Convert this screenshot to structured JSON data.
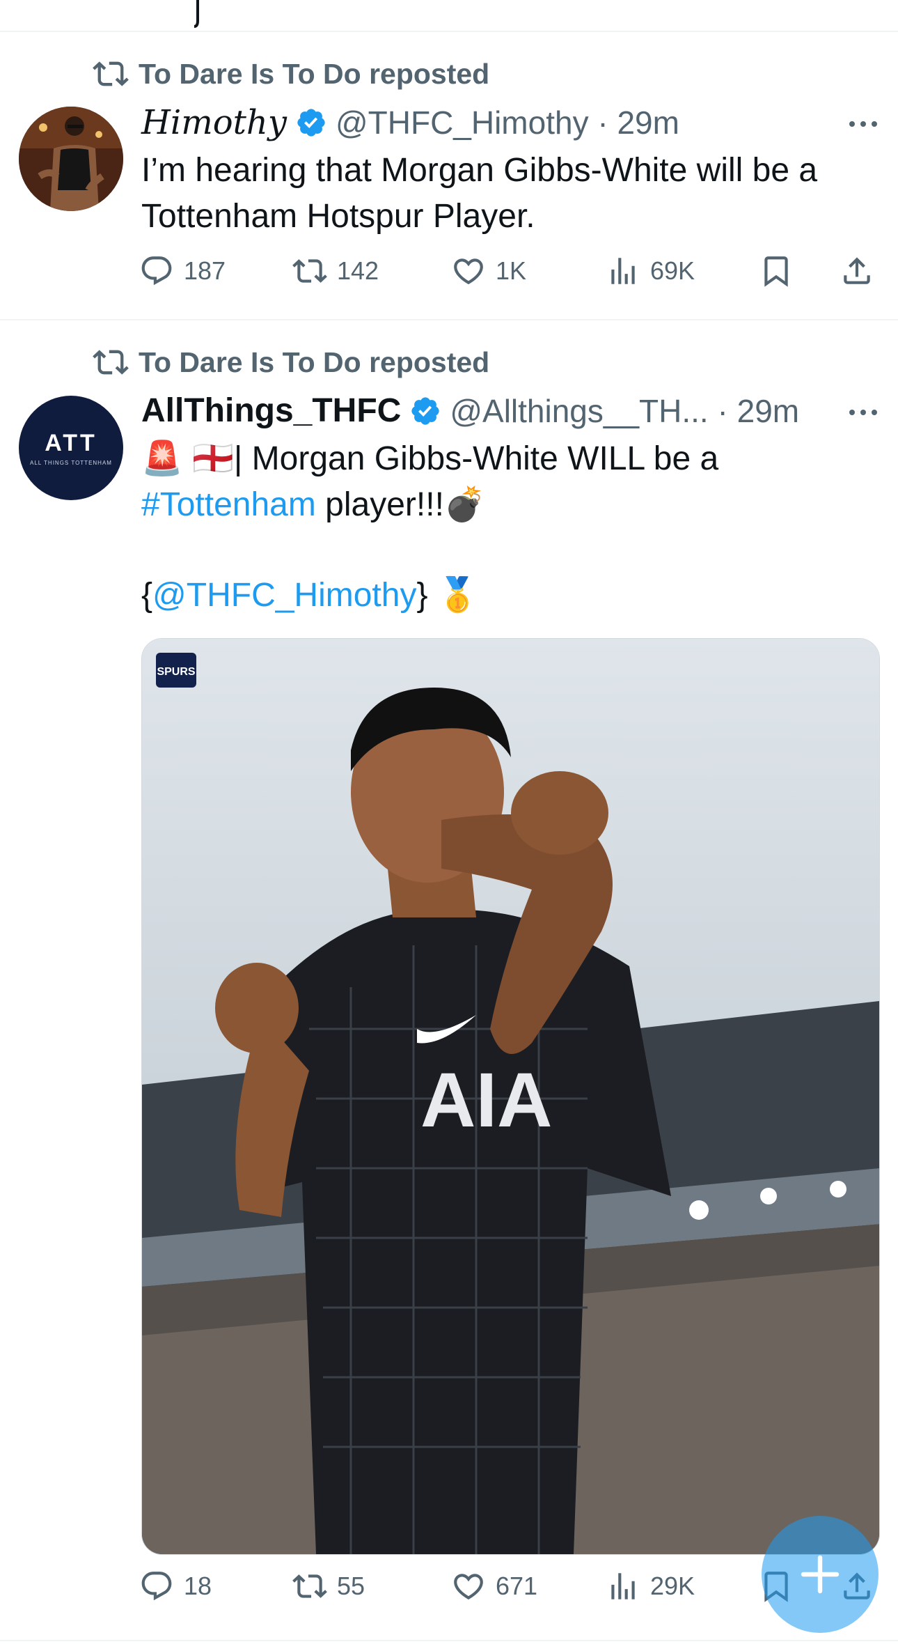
{
  "tweets": [
    {
      "repost_label": "To Dare Is To Do reposted",
      "display_name": "Himothy",
      "handle": "@THFC_Himothy",
      "time": "29m",
      "text": "I’m hearing that Morgan Gibbs-White will be a Tottenham Hotspur Player.",
      "replies": "187",
      "reposts": "142",
      "likes": "1K",
      "views": "69K"
    },
    {
      "repost_label": "To Dare Is To Do reposted",
      "display_name": "AllThings_THFC",
      "handle": "@Allthings__TH...",
      "time": "29m",
      "text_line1_emoji": "🚨 🏴󠁧󠁢󠁥󠁮󠁧󠁿",
      "text_line1": "| Morgan Gibbs-White WILL be a",
      "hashtag": "#Tottenham",
      "text_line2": " player!!!💣",
      "mention_open": "{",
      "mention": "@THFC_Himothy",
      "mention_close": "} 🥇",
      "replies": "18",
      "reposts": "55",
      "likes": "671",
      "views": "29K",
      "avatar_text": "ATT",
      "avatar_subtext": "ALL THINGS TOTTENHAM",
      "media": {
        "badge": "SPURS",
        "shirt_sponsor": "AIA"
      }
    }
  ],
  "colors": {
    "accent": "#1d9bf0",
    "secondary_text": "#536471",
    "divider": "#eff3f4"
  },
  "icons": [
    "repost-icon",
    "verified-badge-icon",
    "more-icon",
    "reply-icon",
    "like-icon",
    "views-icon",
    "bookmark-icon",
    "share-icon",
    "compose-plus-icon"
  ]
}
